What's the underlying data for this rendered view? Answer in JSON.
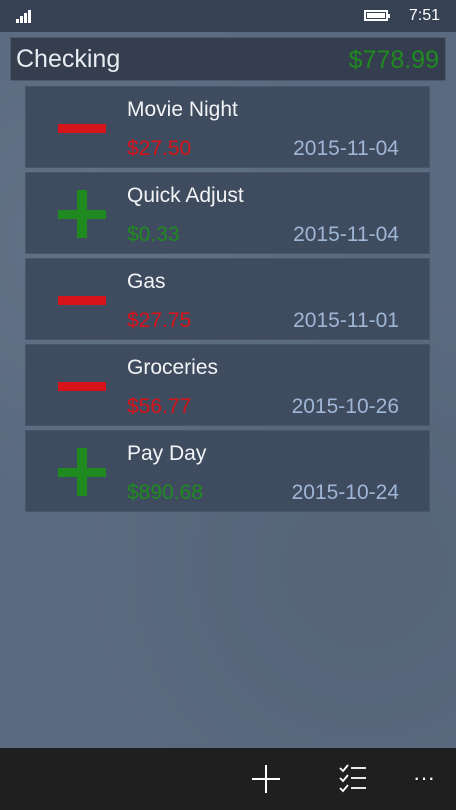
{
  "status_bar": {
    "time": "7:51",
    "signal_icon": "signal-strength-icon",
    "battery_icon": "battery-icon"
  },
  "account": {
    "name": "Checking",
    "balance": "$778.99",
    "balance_color": "#1f8a1f"
  },
  "colors": {
    "debit": "#d8141b",
    "credit": "#1f8a1f",
    "date": "#9fb6d6"
  },
  "transactions": [
    {
      "title": "Movie Night",
      "amount": "$27.50",
      "date": "2015-11-04",
      "type": "debit"
    },
    {
      "title": "Quick Adjust",
      "amount": "$0.33",
      "date": "2015-11-04",
      "type": "credit"
    },
    {
      "title": "Gas",
      "amount": "$27.75",
      "date": "2015-11-01",
      "type": "debit"
    },
    {
      "title": "Groceries",
      "amount": "$56.77",
      "date": "2015-10-26",
      "type": "debit"
    },
    {
      "title": "Pay Day",
      "amount": "$890.68",
      "date": "2015-10-24",
      "type": "credit"
    }
  ],
  "app_bar": {
    "add_icon": "plus-icon",
    "list_icon": "checklist-icon",
    "more_label": "···"
  }
}
